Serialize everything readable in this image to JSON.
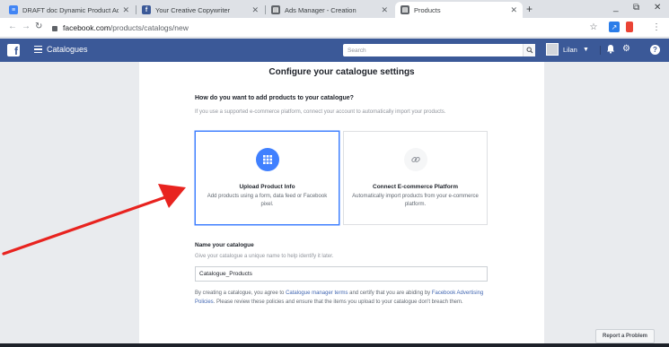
{
  "browser": {
    "tabs": [
      {
        "title": "DRAFT doc Dynamic Product Ad",
        "favicon_color": "#4285f4",
        "favicon_glyph": "≡",
        "active": false
      },
      {
        "title": "Your Creative Copywriter",
        "favicon_color": "#3b5998",
        "favicon_glyph": "f",
        "active": false
      },
      {
        "title": "Ads Manager - Creation",
        "favicon_color": "#5f6368",
        "favicon_glyph": "▤",
        "active": false
      },
      {
        "title": "Products",
        "favicon_color": "#5f6368",
        "favicon_glyph": "▤",
        "active": true
      }
    ],
    "new_tab_glyph": "+",
    "url_host": "facebook.com",
    "url_path": "/products/catalogs/new"
  },
  "fb": {
    "section_title": "Catalogues",
    "search_placeholder": "Search",
    "user_name": "Lilan",
    "brand_color": "#3b5998"
  },
  "page": {
    "title": "Configure your catalogue settings",
    "question": "How do you want to add products to your catalogue?",
    "question_desc": "If you use a supported e-commerce platform, connect your account to automatically import your products.",
    "options": [
      {
        "name": "Upload Product Info",
        "desc": "Add products using a form, data feed or Facebook pixel.",
        "icon": "grid-icon",
        "selected": true
      },
      {
        "name": "Connect E-commerce Platform",
        "desc": "Automatically import products from your e-commerce platform.",
        "icon": "link-icon",
        "selected": false
      }
    ],
    "name_title": "Name your catalogue",
    "name_desc": "Give your catalogue a unique name to help identify it later.",
    "name_value": "Catalogue_Products",
    "terms_pre": "By creating a catalogue, you agree to ",
    "terms_link1": "Catalogue manager terms",
    "terms_mid": " and certify that you are abiding by ",
    "terms_link2": "Facebook Advertising Policies",
    "terms_post": ". Please review these policies and ensure that the items you upload to your catalogue don't breach them.",
    "report_label": "Report a Problem"
  }
}
